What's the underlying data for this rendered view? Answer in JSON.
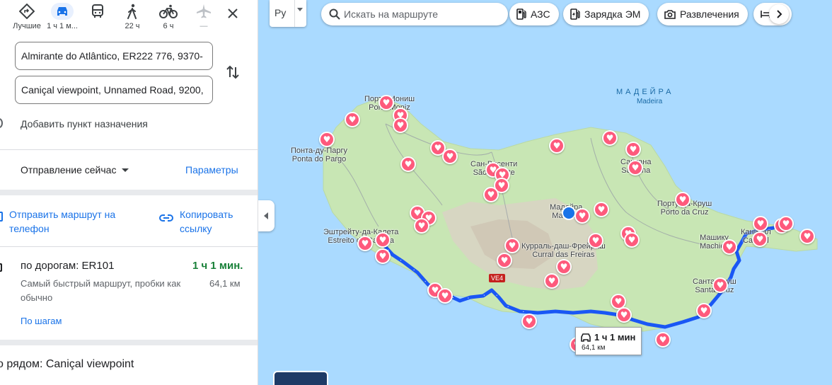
{
  "travel_modes": [
    {
      "name": "best",
      "label": "Лучшие"
    },
    {
      "name": "car",
      "label": "1 ч 1 м..."
    },
    {
      "name": "transit",
      "label": ""
    },
    {
      "name": "walk",
      "label": "22 ч"
    },
    {
      "name": "bike",
      "label": "6 ч"
    },
    {
      "name": "flight",
      "label": "—"
    }
  ],
  "origin": "Almirante do Atlântico, ER222 776, 9370-",
  "destination": "Caniçal viewpoint, Unnamed Road, 9200,",
  "add_destination": "Добавить пункт назначения",
  "depart": "Отправление сейчас",
  "parameters": "Параметры",
  "send_to_phone": "Отправить маршрут на телефон",
  "copy_link": "Копировать ссылку",
  "route": {
    "name": "по дорогам: ER101",
    "time": "1 ч 1 мин.",
    "description": "Самый быстрый маршрут, пробки как обычно",
    "distance": "64,1 км",
    "steps": "По шагам"
  },
  "nearby": "о рядом: Caniçal viewpoint",
  "map": {
    "language_button": "Ру",
    "search_placeholder": "Искать на маршруте",
    "chips": [
      "АЗС",
      "Зарядка ЭМ",
      "Развлечения"
    ],
    "island_label": "МАДЕЙРА",
    "island_label_sub": "Madeira",
    "road_shield": "VE4",
    "places": [
      {
        "ru": "Порто-Мониш",
        "pt": "Porto Moniz"
      },
      {
        "ru": "Понта-ду-Паргу",
        "pt": "Ponta do Pargo"
      },
      {
        "ru": "Сан-Висенти",
        "pt": "São Vicente"
      },
      {
        "ru": "Сантана",
        "pt": "Santana"
      },
      {
        "ru": "Порту-да-Круш",
        "pt": "Porto da Cruz"
      },
      {
        "ru": "Машику",
        "pt": "Machico"
      },
      {
        "ru": "Санта-Круш",
        "pt": "Santa Cruz"
      },
      {
        "ru": "Курраль-даш-Фрейраш",
        "pt": "Curral das Freiras"
      },
      {
        "ru": "Эштрейту-да-Калета",
        "pt": "Estreito da Calheta"
      },
      {
        "ru": "Мадейра",
        "pt": "Madeira"
      },
      {
        "ru": "Канисал",
        "pt": "Caniçal"
      }
    ],
    "route_label": {
      "time": "1 ч 1 мин",
      "distance": "64,1 км"
    }
  },
  "colors": {
    "route": "#1a57f5",
    "accent": "#1a73e8",
    "pin": "#fe5a7c",
    "sea": "#aadaff",
    "land": "#c8e6b4"
  }
}
